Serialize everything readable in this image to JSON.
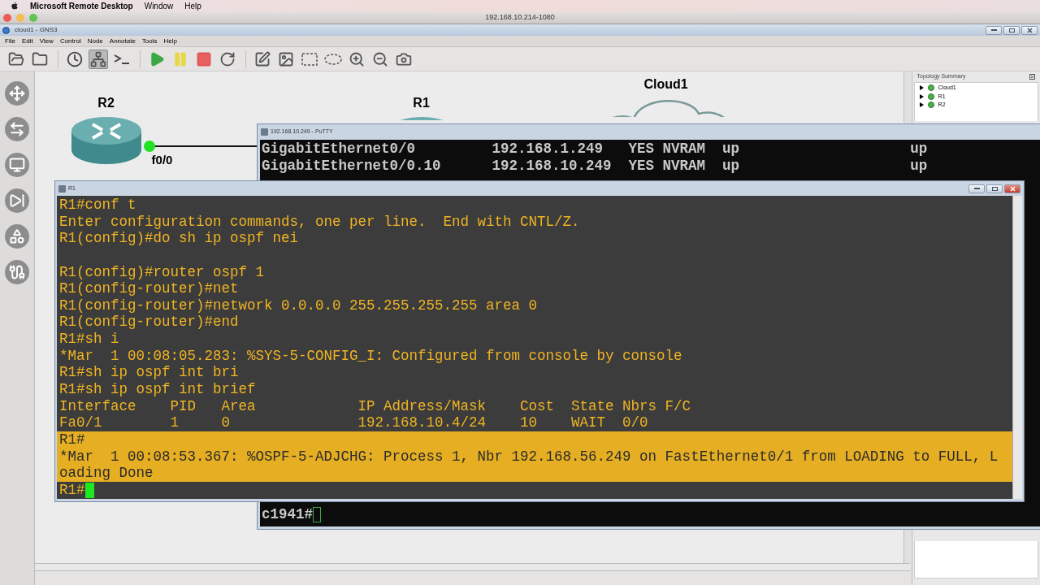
{
  "mac_menubar": {
    "app": "Microsoft Remote Desktop",
    "menus": [
      "Window",
      "Help"
    ]
  },
  "remote_window": {
    "title": "192.168.10.214-1080"
  },
  "gns3": {
    "title": "cloud1 - GNS3",
    "menus": [
      "File",
      "Edit",
      "View",
      "Control",
      "Node",
      "Annotate",
      "Tools",
      "Help"
    ],
    "toolbar": [
      [
        {
          "kind": "new-project",
          "selected": false
        },
        {
          "kind": "open-project",
          "selected": false
        }
      ],
      [
        {
          "kind": "snapshot",
          "selected": false
        },
        {
          "kind": "interface-labels",
          "selected": true
        },
        {
          "kind": "console-all",
          "selected": false
        }
      ],
      [
        {
          "kind": "start",
          "selected": false
        },
        {
          "kind": "suspend",
          "selected": false
        },
        {
          "kind": "stop",
          "selected": false
        },
        {
          "kind": "reload",
          "selected": false
        }
      ],
      [
        {
          "kind": "add-note",
          "selected": false
        },
        {
          "kind": "insert-image",
          "selected": false
        },
        {
          "kind": "rectangle",
          "selected": false
        },
        {
          "kind": "ellipse",
          "selected": false
        },
        {
          "kind": "zoom-in",
          "selected": false
        },
        {
          "kind": "zoom-out",
          "selected": false
        },
        {
          "kind": "screenshot",
          "selected": false
        }
      ]
    ],
    "dock": [
      {
        "kind": "routers"
      },
      {
        "kind": "switches"
      },
      {
        "kind": "end-devices"
      },
      {
        "kind": "security"
      },
      {
        "kind": "all-devices"
      },
      {
        "kind": "add-link"
      }
    ]
  },
  "canvas": {
    "nodes": [
      {
        "kind": "router",
        "label": "R2"
      },
      {
        "kind": "router",
        "label": "R1"
      },
      {
        "kind": "cloud",
        "label": "Cloud1"
      }
    ],
    "interface_label": "f0/0"
  },
  "topology_summary": {
    "title": "Topology Summary",
    "items": [
      {
        "label": "Cloud1",
        "expanded": false
      },
      {
        "label": "R1",
        "expanded": false
      },
      {
        "label": "R2",
        "expanded": false
      }
    ]
  },
  "putty": {
    "title": "192.168.10.249 - PuTTY",
    "lines": [
      "GigabitEthernet0/0         192.168.1.249   YES NVRAM  up                    up",
      "GigabitEthernet0/0.10      192.168.10.249  YES NVRAM  up                    up"
    ],
    "prompt": "c1941#"
  },
  "r1_console": {
    "title": "R1",
    "lines": [
      {
        "kind": "text",
        "text": "R1#conf t",
        "highlighted": false
      },
      {
        "kind": "text",
        "text": "Enter configuration commands, one per line.  End with CNTL/Z.",
        "highlighted": false
      },
      {
        "kind": "text",
        "text": "R1(config)#do sh ip ospf nei",
        "highlighted": false
      },
      {
        "kind": "blank",
        "highlighted": false
      },
      {
        "kind": "text",
        "text": "R1(config)#router ospf 1",
        "highlighted": false
      },
      {
        "kind": "text",
        "text": "R1(config-router)#net",
        "highlighted": false
      },
      {
        "kind": "text",
        "text": "R1(config-router)#network 0.0.0.0 255.255.255.255 area 0",
        "highlighted": false
      },
      {
        "kind": "text",
        "text": "R1(config-router)#end",
        "highlighted": false
      },
      {
        "kind": "text",
        "text": "R1#sh i",
        "highlighted": false
      },
      {
        "kind": "text",
        "text": "*Mar  1 00:08:05.283: %SYS-5-CONFIG_I: Configured from console by console",
        "highlighted": false
      },
      {
        "kind": "text",
        "text": "R1#sh ip ospf int bri",
        "highlighted": false
      },
      {
        "kind": "text",
        "text": "R1#sh ip ospf int brief",
        "highlighted": false
      },
      {
        "kind": "text",
        "text": "Interface    PID   Area            IP Address/Mask    Cost  State Nbrs F/C",
        "highlighted": false
      },
      {
        "kind": "text",
        "text": "Fa0/1        1     0               192.168.10.4/24    10    WAIT  0/0",
        "highlighted": false
      },
      {
        "kind": "text",
        "text": "R1#",
        "highlighted": true
      },
      {
        "kind": "text",
        "text": "*Mar  1 00:08:53.367: %OSPF-5-ADJCHG: Process 1, Nbr 192.168.56.249 on FastEthernet0/1 from LOADING to FULL, L",
        "highlighted": true
      },
      {
        "kind": "text",
        "text": "oading Done",
        "highlighted": true
      },
      {
        "kind": "prompt",
        "text": "R1#",
        "highlighted": false
      }
    ]
  }
}
